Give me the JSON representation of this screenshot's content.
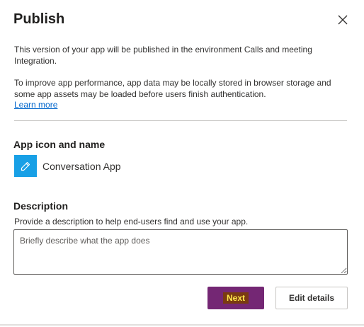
{
  "dialog": {
    "title": "Publish",
    "close_icon": "close-icon",
    "intro": "This version of your app will be published in the environment Calls and meeting Integration.",
    "performance_note": "To improve app performance, app data may be locally stored in browser storage and some app assets may be loaded before users finish authentication.",
    "learn_more": "Learn more"
  },
  "app_section": {
    "heading": "App icon and name",
    "icon": "pencil-icon",
    "icon_color": "#18a0e6",
    "app_name": "Conversation App"
  },
  "description_section": {
    "heading": "Description",
    "hint": "Provide a description to help end-users find and use your app.",
    "placeholder": "Briefly describe what the app does",
    "value": ""
  },
  "actions": {
    "next_label": "Next",
    "next_color": "#742774",
    "edit_label": "Edit details"
  }
}
